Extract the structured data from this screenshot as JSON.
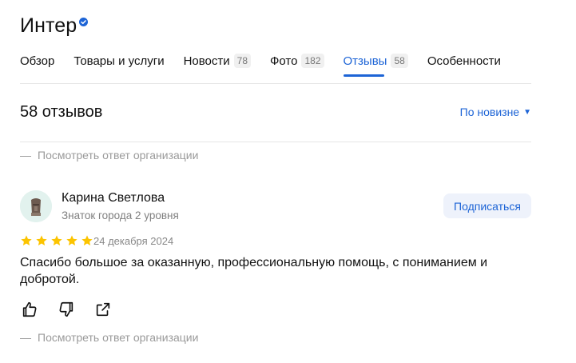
{
  "header": {
    "title": "Интер",
    "verified_icon": "verified-check-icon"
  },
  "tabs": [
    {
      "label": "Обзор",
      "badge": ""
    },
    {
      "label": "Товары и услуги",
      "badge": ""
    },
    {
      "label": "Новости",
      "badge": "78"
    },
    {
      "label": "Фото",
      "badge": "182"
    },
    {
      "label": "Отзывы",
      "badge": "58",
      "active": true
    },
    {
      "label": "Особенности",
      "badge": ""
    }
  ],
  "reviews_header": {
    "count_label": "58 отзывов",
    "sort_label": "По новизне",
    "sort_icon": "caret-down-icon"
  },
  "org_reply_label": "Посмотреть ответ организации",
  "org_reply_dash": "—",
  "review": {
    "author": "Карина Светлова",
    "level": "Знаток города 2 уровня",
    "subscribe_label": "Подписаться",
    "rating": 5,
    "date": "24 декабря 2024",
    "text": "Спасибо большое за оказанную, профессиональную помощь, с пониманием и добротой.",
    "actions": [
      "thumbs-up-icon",
      "thumbs-down-icon",
      "share-icon"
    ]
  },
  "colors": {
    "accent": "#1d64d6",
    "star": "#fcc400",
    "muted": "#9a9a9a"
  }
}
